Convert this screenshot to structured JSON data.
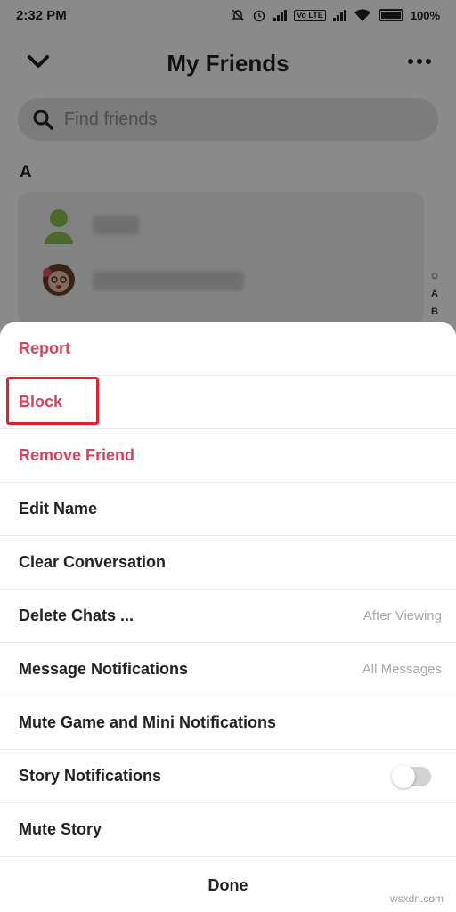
{
  "status_bar": {
    "time": "2:32 PM",
    "volte": "Vo LTE",
    "battery": "100%"
  },
  "header": {
    "title": "My Friends"
  },
  "search": {
    "placeholder": "Find friends"
  },
  "section": {
    "letter": "A"
  },
  "index": [
    "☺",
    "A",
    "B"
  ],
  "menu": {
    "report": "Report",
    "block": "Block",
    "remove_friend": "Remove Friend",
    "edit_name": "Edit Name",
    "clear_conversation": "Clear Conversation",
    "delete_chats": "Delete Chats ...",
    "delete_chats_value": "After Viewing",
    "message_notifications": "Message Notifications",
    "message_notifications_value": "All Messages",
    "mute_game": "Mute Game and Mini Notifications",
    "story_notifications": "Story Notifications",
    "story_notifications_on": false,
    "mute_story": "Mute Story",
    "done": "Done"
  },
  "watermark": "wsxdn.com",
  "colors": {
    "danger": "#d9415d",
    "highlight": "#e0222f"
  }
}
